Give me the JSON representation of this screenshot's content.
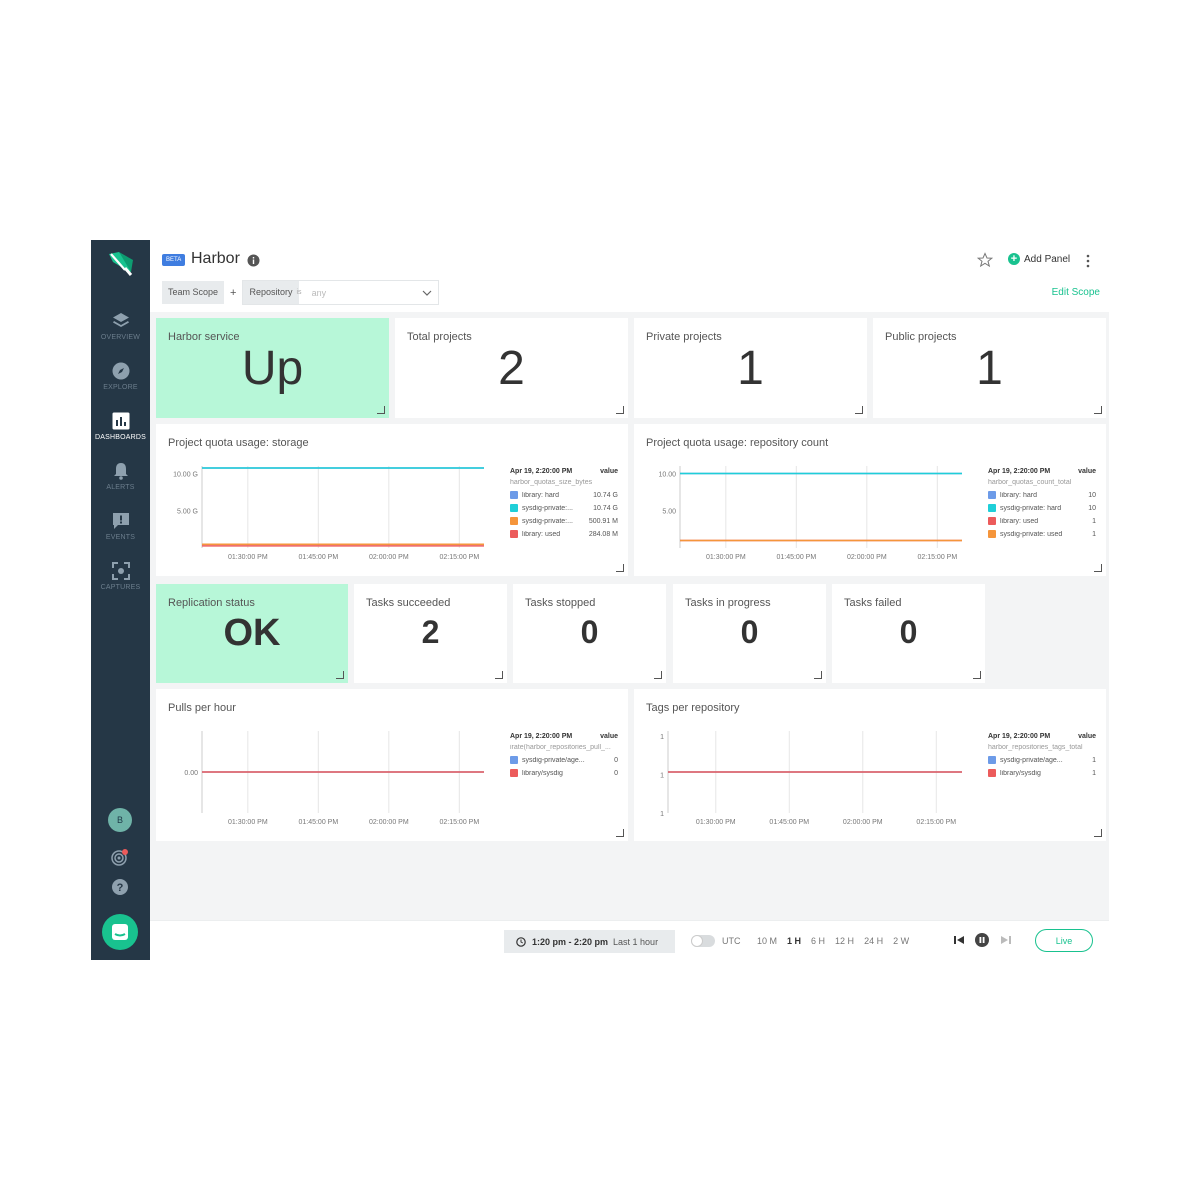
{
  "sidebar": {
    "items": [
      {
        "label": "OVERVIEW",
        "icon": "layers-icon"
      },
      {
        "label": "EXPLORE",
        "icon": "compass-icon"
      },
      {
        "label": "DASHBOARDS",
        "icon": "bar-chart-icon"
      },
      {
        "label": "ALERTS",
        "icon": "bell-icon"
      },
      {
        "label": "EVENTS",
        "icon": "alert-message-icon"
      },
      {
        "label": "CAPTURES",
        "icon": "capture-icon"
      }
    ],
    "active": "DASHBOARDS",
    "avatar_initial": "B"
  },
  "header": {
    "badge": "BETA",
    "title": "Harbor",
    "add_panel_label": "Add Panel",
    "scope": {
      "team_scope": "Team Scope",
      "plus": "+",
      "key": "Repository",
      "operator": "is",
      "value_placeholder": "any"
    },
    "edit_scope": "Edit Scope"
  },
  "stats_row1": [
    {
      "title": "Harbor service",
      "value": "Up"
    },
    {
      "title": "Total projects",
      "value": "2"
    },
    {
      "title": "Private projects",
      "value": "1"
    },
    {
      "title": "Public projects",
      "value": "1"
    }
  ],
  "charts": {
    "storage": {
      "title": "Project quota usage: storage",
      "legend_time": "Apr 19, 2:20:00 PM",
      "legend_value_header": "value",
      "legend_metric": "harbor_quotas_size_bytes",
      "legend": [
        {
          "name": "library: hard",
          "value": "10.74 G",
          "color": "#6d9be8"
        },
        {
          "name": "sysdig-private:...",
          "value": "10.74 G",
          "color": "#1fcfd8"
        },
        {
          "name": "sysdig-private:...",
          "value": "500.91 M",
          "color": "#f5953b"
        },
        {
          "name": "library: used",
          "value": "284.08 M",
          "color": "#ec5b5b"
        }
      ]
    },
    "repo_count": {
      "title": "Project quota usage: repository count",
      "legend_time": "Apr 19, 2:20:00 PM",
      "legend_value_header": "value",
      "legend_metric": "harbor_quotas_count_total",
      "legend": [
        {
          "name": "library: hard",
          "value": "10",
          "color": "#6d9be8"
        },
        {
          "name": "sysdig-private: hard",
          "value": "10",
          "color": "#1fcfd8"
        },
        {
          "name": "library: used",
          "value": "1",
          "color": "#ec5b5b"
        },
        {
          "name": "sysdig-private: used",
          "value": "1",
          "color": "#f5953b"
        }
      ]
    },
    "pulls": {
      "title": "Pulls per hour",
      "legend_time": "Apr 19, 2:20:00 PM",
      "legend_value_header": "value",
      "legend_metric": "irate(harbor_repositories_pull_...",
      "legend": [
        {
          "name": "sysdig-private/age...",
          "value": "0",
          "color": "#6d9be8"
        },
        {
          "name": "library/sysdig",
          "value": "0",
          "color": "#ec5b5b"
        }
      ]
    },
    "tags": {
      "title": "Tags per repository",
      "legend_time": "Apr 19, 2:20:00 PM",
      "legend_value_header": "value",
      "legend_metric": "harbor_repositories_tags_total",
      "legend": [
        {
          "name": "sysdig-private/age...",
          "value": "1",
          "color": "#6d9be8"
        },
        {
          "name": "library/sysdig",
          "value": "1",
          "color": "#ec5b5b"
        }
      ]
    }
  },
  "chart_data": [
    {
      "type": "line",
      "ylabel_ticks": [
        "10.00 G",
        "5.00 G"
      ],
      "x_ticks": [
        "01:30:00 PM",
        "01:45:00 PM",
        "02:00:00 PM",
        "02:15:00 PM"
      ],
      "ylim": [
        0,
        11
      ],
      "series": [
        {
          "name": "library: hard",
          "color": "#6d9be8",
          "y": 10.74
        },
        {
          "name": "sysdig-private:...",
          "color": "#1fcfd8",
          "y": 10.74
        },
        {
          "name": "sysdig-private:...",
          "color": "#f5953b",
          "y": 0.50091
        },
        {
          "name": "library: used",
          "color": "#ec5b5b",
          "y": 0.28408
        }
      ]
    },
    {
      "type": "line",
      "ylabel_ticks": [
        "10.00",
        "5.00"
      ],
      "x_ticks": [
        "01:30:00 PM",
        "01:45:00 PM",
        "02:00:00 PM",
        "02:15:00 PM"
      ],
      "ylim": [
        0,
        11
      ],
      "series": [
        {
          "name": "library: hard",
          "color": "#6d9be8",
          "y": 10
        },
        {
          "name": "sysdig-private: hard",
          "color": "#1fcfd8",
          "y": 10
        },
        {
          "name": "library: used",
          "color": "#ec5b5b",
          "y": 1
        },
        {
          "name": "sysdig-private: used",
          "color": "#f5953b",
          "y": 1
        }
      ]
    },
    {
      "type": "line",
      "ylabel_ticks": [
        "0.00"
      ],
      "x_ticks": [
        "01:30:00 PM",
        "01:45:00 PM",
        "02:00:00 PM",
        "02:15:00 PM"
      ],
      "series": [
        {
          "name": "sysdig-private/age...",
          "color": "#6d9be8",
          "y": 0
        },
        {
          "name": "library/sysdig",
          "color": "#ec5b5b",
          "y": 0
        }
      ]
    },
    {
      "type": "line",
      "ylabel_ticks": [
        "1",
        "1",
        "1"
      ],
      "x_ticks": [
        "01:30:00 PM",
        "01:45:00 PM",
        "02:00:00 PM",
        "02:15:00 PM"
      ],
      "series": [
        {
          "name": "sysdig-private/age...",
          "color": "#6d9be8",
          "y": 1
        },
        {
          "name": "library/sysdig",
          "color": "#ec5b5b",
          "y": 1
        }
      ]
    }
  ],
  "stats_row2": [
    {
      "title": "Replication status",
      "value": "OK"
    },
    {
      "title": "Tasks succeeded",
      "value": "2"
    },
    {
      "title": "Tasks stopped",
      "value": "0"
    },
    {
      "title": "Tasks in progress",
      "value": "0"
    },
    {
      "title": "Tasks failed",
      "value": "0"
    }
  ],
  "footer": {
    "time_range": "1:20 pm - 2:20 pm",
    "time_label": "Last 1 hour",
    "utc_label": "UTC",
    "ranges": [
      "10 M",
      "1 H",
      "6 H",
      "12 H",
      "24 H",
      "2 W"
    ],
    "selected_range": "1 H",
    "live_label": "Live"
  },
  "colors": {
    "accent": "#19c28f",
    "sidebar": "#253746",
    "status_green": "#b7f7d8",
    "beta": "#3f7de0"
  }
}
